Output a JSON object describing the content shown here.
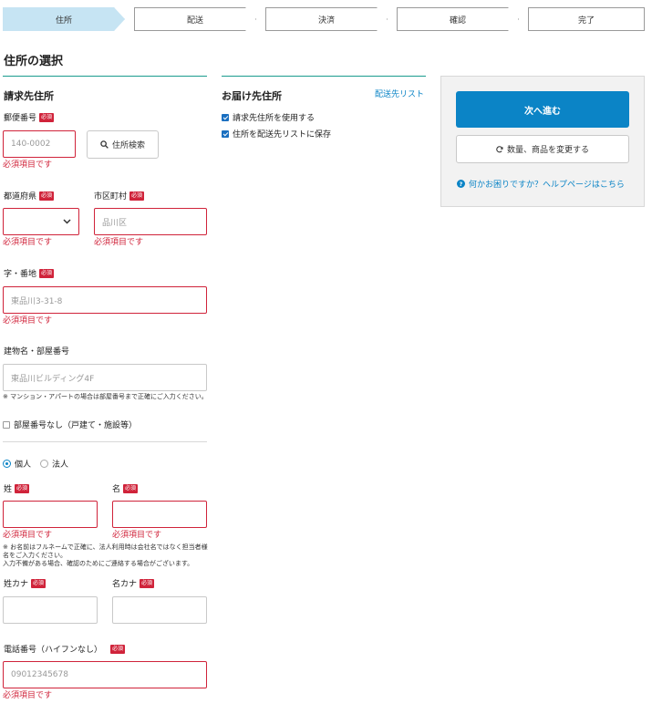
{
  "steps": [
    {
      "label": "住所"
    },
    {
      "label": "配送"
    },
    {
      "label": "決済"
    },
    {
      "label": "確認"
    },
    {
      "label": "完了"
    }
  ],
  "page_title": "住所の選択",
  "billing": {
    "title": "請求先住所",
    "required_badge": "必須",
    "postal": {
      "label": "郵便番号",
      "placeholder": "140-0002",
      "error": "必須項目です"
    },
    "postal_search_button": "住所検索",
    "prefecture": {
      "label": "都道府県",
      "value": "",
      "error": "必須項目です"
    },
    "city": {
      "label": "市区町村",
      "placeholder": "品川区",
      "error": "必須項目です"
    },
    "street": {
      "label": "字・番地",
      "placeholder": "東品川3-31-8",
      "error": "必須項目です"
    },
    "building": {
      "label": "建物名・部屋番号",
      "placeholder": "東品川ビルディング4F",
      "note": "※ マンション・アパートの場合は部屋番号まで正確にご入力ください。"
    },
    "no_room_checkbox": "部屋番号なし（戸建て・施設等）",
    "type_individual": "個人",
    "type_corporate": "法人",
    "last_name": {
      "label": "姓",
      "value": "",
      "error": "必須項目です"
    },
    "first_name": {
      "label": "名",
      "value": "",
      "error": "必須項目です"
    },
    "name_note_1": "※ お名前はフルネームで正確に、法人利用時は会社名ではなく担当者様名をご入力ください。",
    "name_note_2": "入力不備がある場合、確認のためにご連絡する場合がございます。",
    "last_kana": {
      "label": "姓カナ",
      "value": ""
    },
    "first_kana": {
      "label": "名カナ",
      "value": ""
    },
    "phone": {
      "label": "電話番号（ハイフンなし）",
      "placeholder": "09012345678",
      "error": "必須項目です"
    }
  },
  "delivery": {
    "title": "お届け先住所",
    "list_link": "配送先リスト",
    "use_billing": "請求先住所を使用する",
    "save_to_list": "住所を配送先リストに保存"
  },
  "sidebar": {
    "next_button": "次へ進む",
    "change_button": "数量、商品を変更する",
    "help_link": "何かお困りですか？ヘルプページはこちら"
  },
  "colors": {
    "accent": "#0b84c6",
    "error": "#d0233a",
    "step_active": "#c6e4f3",
    "rule": "#1a9b8e"
  }
}
